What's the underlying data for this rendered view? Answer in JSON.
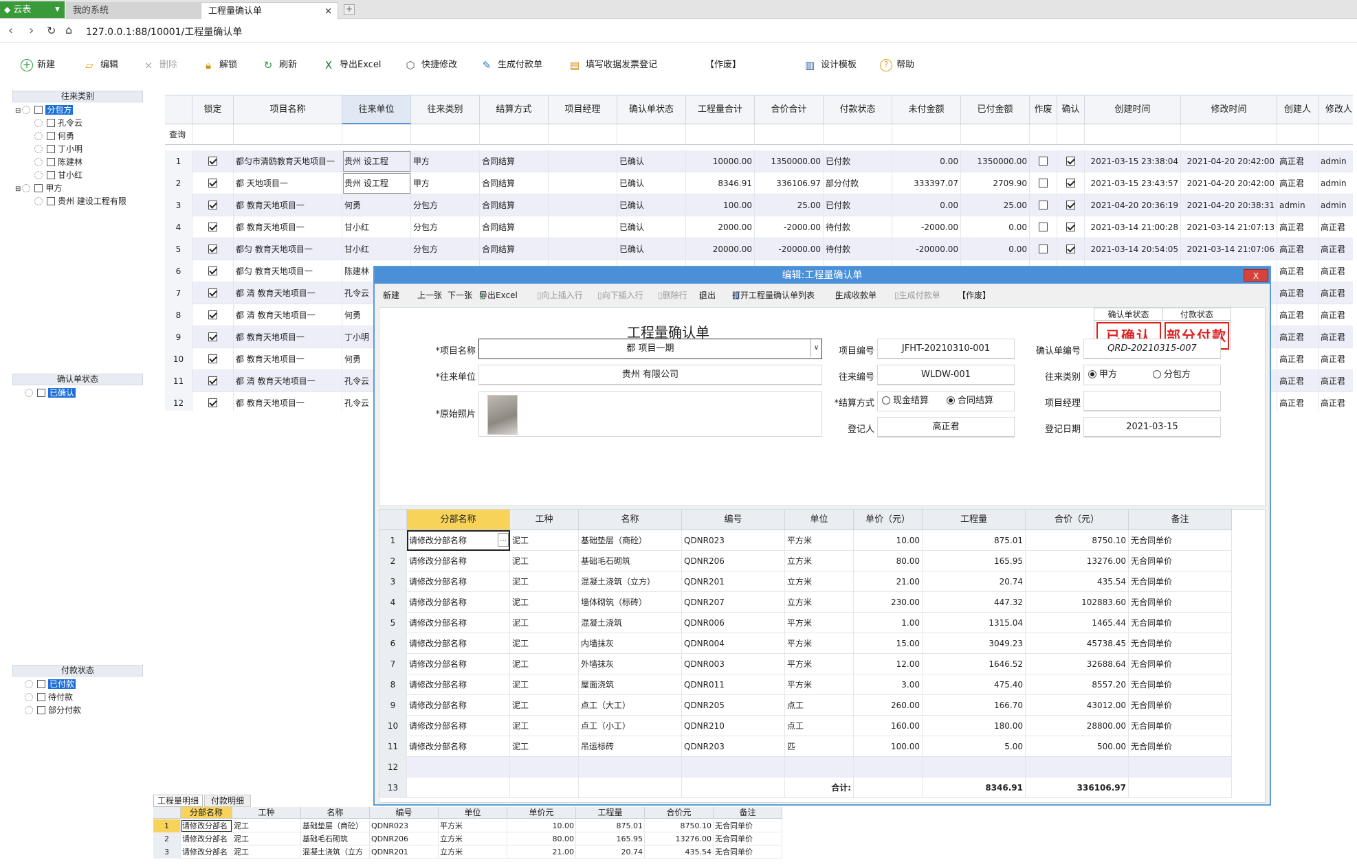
{
  "browser": {
    "tabs": [
      {
        "label": "云表"
      },
      {
        "label": "我的系统"
      },
      {
        "label": "工程量确认单"
      }
    ],
    "url": "127.0.0.1:88/10001/工程量确认单"
  },
  "toolbar": {
    "new": "新建",
    "edit": "编辑",
    "delete": "删除",
    "unlock": "解锁",
    "refresh": "刷新",
    "export_excel": "导出Excel",
    "quick_edit": "快捷修改",
    "gen_payment": "生成付款单",
    "fill_receipt": "填写收据发票登记",
    "void": "【作废】",
    "design_template": "设计模板",
    "help": "帮助"
  },
  "left": {
    "partner_type": {
      "title": "往来类别",
      "items": [
        "分包方",
        "孔令云",
        "何勇",
        "丁小明",
        "陈建林",
        "甘小红",
        "甲方",
        "贵州 建设工程有限"
      ]
    },
    "confirm_status": {
      "title": "确认单状态",
      "items": [
        "已确认"
      ]
    },
    "pay_status": {
      "title": "付款状态",
      "items": [
        "已付款",
        "待付款",
        "部分付款"
      ]
    }
  },
  "grid": {
    "headers": [
      "锁定",
      "项目名称",
      "往来单位",
      "往来类别",
      "结算方式",
      "项目经理",
      "确认单状态",
      "工程量合计",
      "合价合计",
      "付款状态",
      "未付金额",
      "已付金额",
      "作废",
      "确认",
      "创建时间",
      "修改时间",
      "创建人",
      "修改人"
    ],
    "query_label": "查询",
    "rows": [
      {
        "no": "1",
        "lock": true,
        "project": "都匀市清鸥教育天地项目一",
        "unit": "贵州 设工程",
        "type": "甲方",
        "settle": "合同结算",
        "mgr": "",
        "status": "已确认",
        "qty": "10000.00",
        "total": "1350000.00",
        "pay": "已付款",
        "unpaid": "0.00",
        "paid": "1350000.00",
        "void": false,
        "confirm": true,
        "created": "2021-03-15 23:38:04",
        "modified": "2021-04-20 20:42:00",
        "creator": "高正君",
        "modifier": "admin"
      },
      {
        "no": "2",
        "lock": true,
        "project": "都 天地项目一",
        "unit": "贵州 设工程",
        "type": "甲方",
        "settle": "合同结算",
        "mgr": "",
        "status": "已确认",
        "qty": "8346.91",
        "total": "336106.97",
        "pay": "部分付款",
        "unpaid": "333397.07",
        "paid": "2709.90",
        "void": false,
        "confirm": true,
        "created": "2021-03-15 23:43:57",
        "modified": "2021-04-20 20:42:00",
        "creator": "高正君",
        "modifier": "admin"
      },
      {
        "no": "3",
        "lock": true,
        "project": "都 教育天地项目一",
        "unit": "何勇",
        "type": "分包方",
        "settle": "合同结算",
        "mgr": "",
        "status": "已确认",
        "qty": "100.00",
        "total": "25.00",
        "pay": "已付款",
        "unpaid": "0.00",
        "paid": "25.00",
        "void": false,
        "confirm": true,
        "created": "2021-04-20 20:36:19",
        "modified": "2021-04-20 20:38:31",
        "creator": "admin",
        "modifier": "admin"
      },
      {
        "no": "4",
        "lock": true,
        "project": "都 教育天地项目一",
        "unit": "甘小红",
        "type": "分包方",
        "settle": "合同结算",
        "mgr": "",
        "status": "已确认",
        "qty": "2000.00",
        "total": "-2000.00",
        "pay": "待付款",
        "unpaid": "-2000.00",
        "paid": "0.00",
        "void": false,
        "confirm": true,
        "created": "2021-03-14 21:00:28",
        "modified": "2021-03-14 21:07:13",
        "creator": "高正君",
        "modifier": "高正君"
      },
      {
        "no": "5",
        "lock": true,
        "project": "都匀 教育天地项目一",
        "unit": "甘小红",
        "type": "分包方",
        "settle": "合同结算",
        "mgr": "",
        "status": "已确认",
        "qty": "20000.00",
        "total": "-20000.00",
        "pay": "待付款",
        "unpaid": "-20000.00",
        "paid": "0.00",
        "void": false,
        "confirm": true,
        "created": "2021-03-14 20:54:05",
        "modified": "2021-03-14 21:07:06",
        "creator": "高正君",
        "modifier": "高正君"
      },
      {
        "no": "6",
        "lock": true,
        "project": "都匀 教育天地项目一",
        "unit": "陈建林",
        "type": "",
        "settle": "",
        "mgr": "",
        "status": "",
        "qty": "",
        "total": "",
        "pay": "",
        "unpaid": "",
        "paid": "",
        "void": false,
        "confirm": true,
        "created": "",
        "modified": "",
        "creator": "高正君",
        "modifier": "高正君"
      },
      {
        "no": "7",
        "lock": true,
        "project": "都 清 教育天地项目一",
        "unit": "孔令云",
        "created": "",
        "modified": "",
        "creator": "高正君",
        "modifier": "高正君"
      },
      {
        "no": "8",
        "lock": true,
        "project": "都 清 教育天地项目一",
        "unit": "何勇",
        "created": "",
        "modified": "",
        "creator": "高正君",
        "modifier": "高正君"
      },
      {
        "no": "9",
        "lock": true,
        "project": "都 教育天地项目一",
        "unit": "丁小明",
        "created": "",
        "modified": "",
        "creator": "高正君",
        "modifier": "高正君"
      },
      {
        "no": "10",
        "lock": true,
        "project": "都 教育天地项目一",
        "unit": "何勇",
        "created": "",
        "modified": "",
        "creator": "高正君",
        "modifier": "高正君"
      },
      {
        "no": "11",
        "lock": true,
        "project": "都 清 教育天地项目一",
        "unit": "孔令云",
        "created": "",
        "modified": "",
        "creator": "高正君",
        "modifier": "高正君"
      },
      {
        "no": "12",
        "lock": true,
        "project": "都 教育天地项目一",
        "unit": "孔令云",
        "created": "",
        "modified": "",
        "creator": "高正君",
        "modifier": "高正君"
      }
    ]
  },
  "dialog": {
    "title": "编辑:工程量确认单",
    "close": "X",
    "toolbar": [
      "新建",
      "上一张",
      "下一张",
      "导出Excel",
      "向上插入行",
      "向下插入行",
      "删除行",
      "退出",
      "打开工程量确认单列表",
      "生成收款单",
      "生成付款单",
      "【作废】"
    ],
    "form_title": "工程量确认单",
    "status_hdr_confirm": "确认单状态",
    "status_hdr_pay": "付款状态",
    "stamp_confirm": "已确认",
    "stamp_pay": "部分付款",
    "labels": {
      "project": "*项目名称",
      "partner": "*往来单位",
      "photo": "*原始照片",
      "proj_no": "项目编号",
      "partner_no": "往来编号",
      "settle": "*结算方式",
      "register": "登记人",
      "confirm_no": "确认单编号",
      "partner_type": "往来类别",
      "mgr": "项目经理",
      "reg_date": "登记日期"
    },
    "values": {
      "project": "都 项目一期",
      "partner": "贵州 有限公司",
      "proj_no": "JFHT-20210310-001",
      "partner_no": "WLDW-001",
      "register": "高正君",
      "confirm_no": "QRD-20210315-007",
      "reg_date": "2021-03-15",
      "mgr": ""
    },
    "options": {
      "settle_cash": "现金结算",
      "settle_contract": "合同结算",
      "type_a": "甲方",
      "type_sub": "分包方"
    },
    "detail_headers": [
      "分部名称",
      "工种",
      "名称",
      "编号",
      "单位",
      "单价（元）",
      "工程量",
      "合价（元）",
      "备注"
    ],
    "detail_rows": [
      [
        "1",
        "请修改分部名称",
        "泥工",
        "基础垫层（商砼）",
        "QDNR023",
        "平方米",
        "10.00",
        "875.01",
        "8750.10",
        "无合同单价"
      ],
      [
        "2",
        "请修改分部名称",
        "泥工",
        "基础毛石砌筑",
        "QDNR206",
        "立方米",
        "80.00",
        "165.95",
        "13276.00",
        "无合同单价"
      ],
      [
        "3",
        "请修改分部名称",
        "泥工",
        "混凝土浇筑（立方）",
        "QDNR201",
        "立方米",
        "21.00",
        "20.74",
        "435.54",
        "无合同单价"
      ],
      [
        "4",
        "请修改分部名称",
        "泥工",
        "墙体砌筑（标砖）",
        "QDNR207",
        "立方米",
        "230.00",
        "447.32",
        "102883.60",
        "无合同单价"
      ],
      [
        "5",
        "请修改分部名称",
        "泥工",
        "混凝土浇筑",
        "QDNR006",
        "平方米",
        "1.00",
        "1315.04",
        "1465.44",
        "无合同单价"
      ],
      [
        "6",
        "请修改分部名称",
        "泥工",
        "内墙抹灰",
        "QDNR004",
        "平方米",
        "15.00",
        "3049.23",
        "45738.45",
        "无合同单价"
      ],
      [
        "7",
        "请修改分部名称",
        "泥工",
        "外墙抹灰",
        "QDNR003",
        "平方米",
        "12.00",
        "1646.52",
        "32688.64",
        "无合同单价"
      ],
      [
        "8",
        "请修改分部名称",
        "泥工",
        "屋面浇筑",
        "QDNR011",
        "平方米",
        "3.00",
        "475.40",
        "8557.20",
        "无合同单价"
      ],
      [
        "9",
        "请修改分部名称",
        "泥工",
        "点工（大工）",
        "QDNR205",
        "点工",
        "260.00",
        "166.70",
        "43012.00",
        "无合同单价"
      ],
      [
        "10",
        "请修改分部名称",
        "泥工",
        "点工（小工）",
        "QDNR210",
        "点工",
        "160.00",
        "180.00",
        "28800.00",
        "无合同单价"
      ],
      [
        "11",
        "请修改分部名称",
        "泥工",
        "吊运标砖",
        "QDNR203",
        "匹",
        "100.00",
        "5.00",
        "500.00",
        "无合同单价"
      ],
      [
        "12",
        "",
        "",
        "",
        "",
        "",
        "",
        "",
        "",
        ""
      ],
      [
        "13",
        "",
        "",
        "",
        "",
        "合计:",
        "",
        "8346.91",
        "336106.97",
        ""
      ]
    ]
  },
  "bottom": {
    "tabs": [
      "工程量明细",
      "付款明细"
    ],
    "headers": [
      "分部名称",
      "工种",
      "名称",
      "编号",
      "单位",
      "单价元",
      "工程量",
      "合价元",
      "备注"
    ],
    "rows": [
      [
        "1",
        "请修改分部名",
        "泥工",
        "基础垫层（商砼）",
        "QDNR023",
        "平方米",
        "10.00",
        "875.01",
        "8750.10",
        "无合同单价"
      ],
      [
        "2",
        "请修改分部名",
        "泥工",
        "基础毛石砌筑",
        "QDNR206",
        "立方米",
        "80.00",
        "165.95",
        "13276.00",
        "无合同单价"
      ],
      [
        "3",
        "请修改分部名",
        "泥工",
        "混凝土浇筑（立方",
        "QDNR201",
        "立方米",
        "21.00",
        "20.74",
        "435.54",
        "无合同单价"
      ]
    ]
  }
}
